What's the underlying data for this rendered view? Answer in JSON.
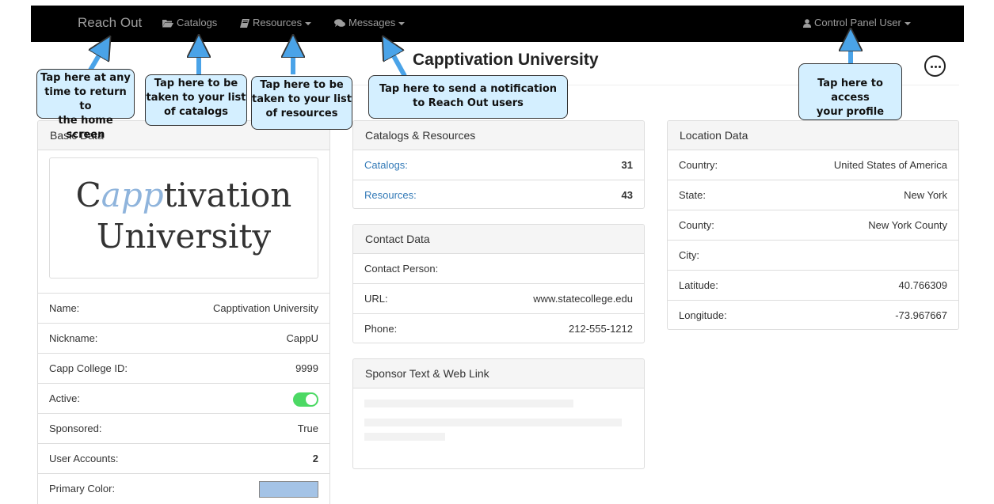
{
  "nav": {
    "brand": "Reach Out",
    "catalogs": "Catalogs",
    "resources": "Resources",
    "messages": "Messages",
    "user": "Control Panel User"
  },
  "page": {
    "title": "Capptivation University"
  },
  "basic": {
    "heading": "Basic Data",
    "logo_line1_a": "C",
    "logo_line1_b": "app",
    "logo_line1_c": "tivation",
    "logo_line2": "University",
    "rows": [
      {
        "label": "Name:",
        "value": "Capptivation University"
      },
      {
        "label": "Nickname:",
        "value": "CappU"
      },
      {
        "label": "Capp College ID:",
        "value": "9999"
      },
      {
        "label": "Active:",
        "value": "on"
      },
      {
        "label": "Sponsored:",
        "value": "True"
      },
      {
        "label": "User Accounts:",
        "value": "2"
      },
      {
        "label": "Primary Color:",
        "value": "#a4c3e6"
      }
    ]
  },
  "catalogs_resources": {
    "heading": "Catalogs & Resources",
    "rows": [
      {
        "label": "Catalogs:",
        "value": "31"
      },
      {
        "label": "Resources:",
        "value": "43"
      }
    ]
  },
  "contact": {
    "heading": "Contact Data",
    "rows": [
      {
        "label": "Contact Person:",
        "value": ""
      },
      {
        "label": "URL:",
        "value": "www.statecollege.edu"
      },
      {
        "label": "Phone:",
        "value": "212-555-1212"
      }
    ]
  },
  "sponsor": {
    "heading": "Sponsor Text & Web Link"
  },
  "location": {
    "heading": "Location Data",
    "rows": [
      {
        "label": "Country:",
        "value": "United States of America"
      },
      {
        "label": "State:",
        "value": "New York"
      },
      {
        "label": "County:",
        "value": "New York County"
      },
      {
        "label": "City:",
        "value": ""
      },
      {
        "label": "Latitude:",
        "value": "40.766309"
      },
      {
        "label": "Longitude:",
        "value": "-73.967667"
      }
    ]
  },
  "callouts": {
    "home": {
      "l1": "Tap here at any",
      "l2": "time to return to",
      "l3": "the home screen"
    },
    "catalogs": {
      "l1": "Tap here to be",
      "l2": "taken to your list",
      "l3": "of catalogs"
    },
    "resources": {
      "l1": "Tap here to be",
      "l2": "taken to your list",
      "l3": "of resources"
    },
    "messages": {
      "l1": "Tap here to send a notification",
      "l2": "to Reach Out users"
    },
    "profile": {
      "l1": "Tap here to access",
      "l2": "your profile"
    }
  },
  "colors": {
    "navbar": "#000000",
    "callout_fill": "#d4efff",
    "arrow": "#4aa3e8",
    "toggle_on": "#4cd964",
    "link": "#337ab7"
  },
  "icons": {
    "catalogs": "folder-open-icon",
    "resources": "book-icon",
    "messages": "comments-icon",
    "user": "user-icon",
    "more": "ellipsis-circle-icon"
  }
}
